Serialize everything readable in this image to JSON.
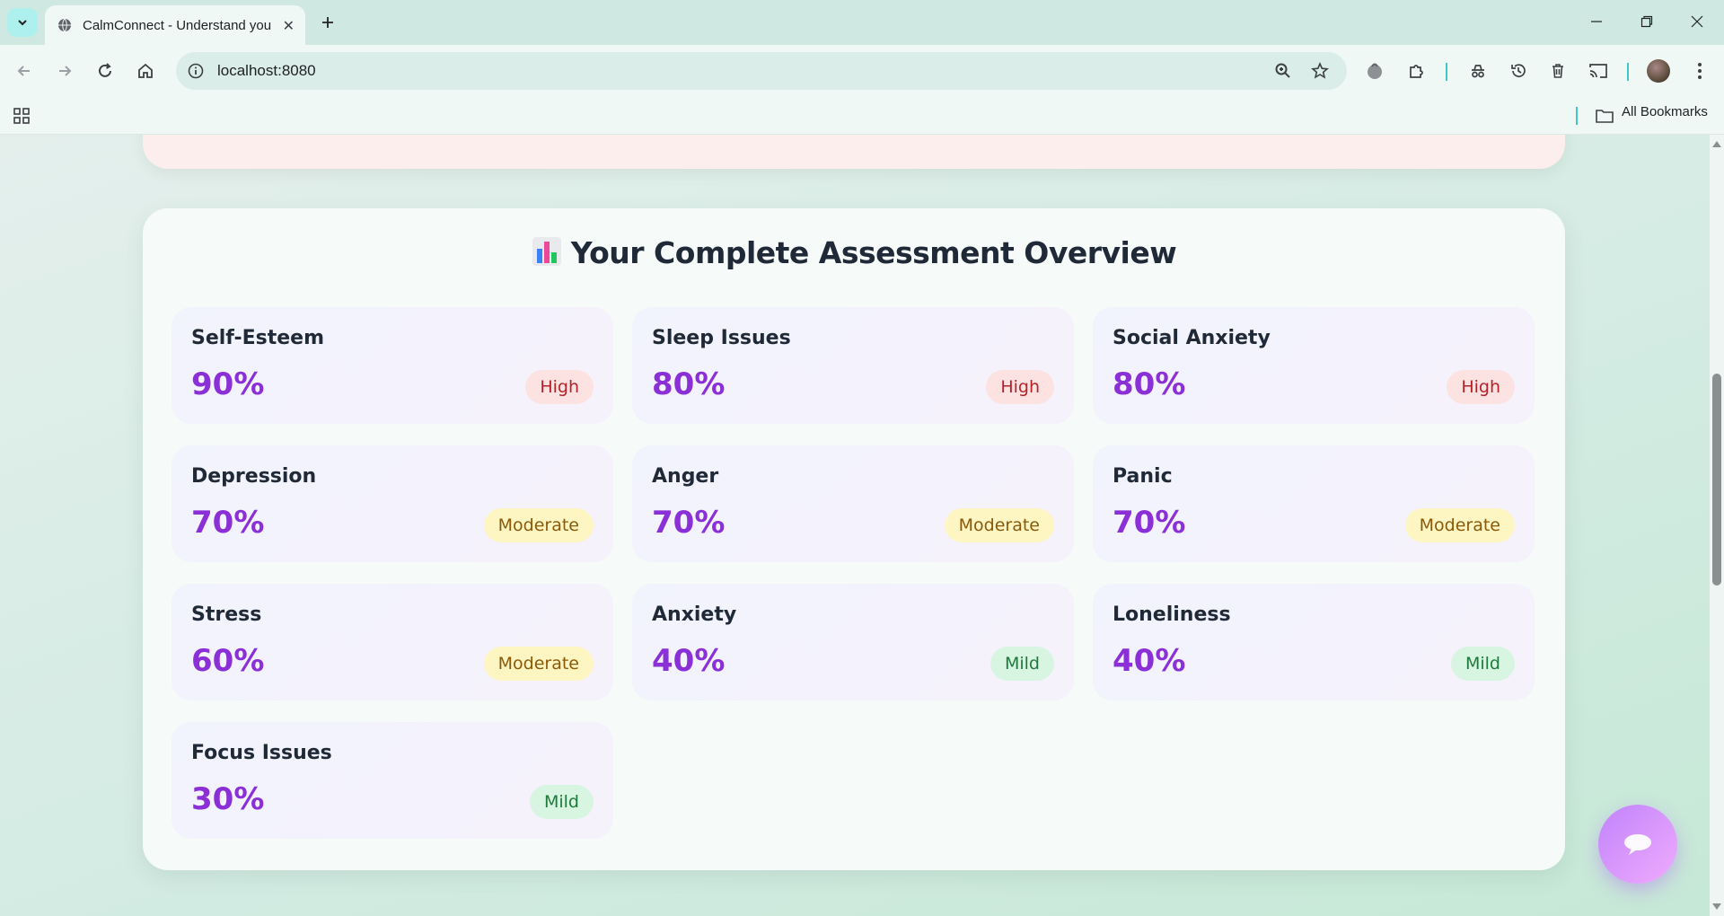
{
  "browser": {
    "tab_title": "CalmConnect - Understand your mind",
    "url": "localhost:8080",
    "bookmarks_label": "All Bookmarks",
    "icons": [
      "tab-search-icon",
      "globe-icon",
      "close-icon",
      "plus-icon",
      "minimize-icon",
      "restore-icon",
      "window-close-icon",
      "back-icon",
      "forward-icon",
      "reload-icon",
      "home-icon",
      "site-info-icon",
      "zoom-icon",
      "star-icon",
      "extension-icon",
      "puzzle-icon",
      "incognito-icon",
      "history-icon",
      "trash-icon",
      "cast-icon",
      "avatar",
      "menu-dots-icon",
      "apps-grid-icon",
      "folder-icon"
    ]
  },
  "overview": {
    "title": "Your Complete Assessment Overview",
    "title_icon": "bar-chart-icon",
    "items": [
      {
        "name": "Self-Esteem",
        "percent": "90%",
        "level": "High"
      },
      {
        "name": "Sleep Issues",
        "percent": "80%",
        "level": "High"
      },
      {
        "name": "Social Anxiety",
        "percent": "80%",
        "level": "High"
      },
      {
        "name": "Depression",
        "percent": "70%",
        "level": "Moderate"
      },
      {
        "name": "Anger",
        "percent": "70%",
        "level": "Moderate"
      },
      {
        "name": "Panic",
        "percent": "70%",
        "level": "Moderate"
      },
      {
        "name": "Stress",
        "percent": "60%",
        "level": "Moderate"
      },
      {
        "name": "Anxiety",
        "percent": "40%",
        "level": "Mild"
      },
      {
        "name": "Loneliness",
        "percent": "40%",
        "level": "Mild"
      },
      {
        "name": "Focus Issues",
        "percent": "30%",
        "level": "Mild"
      }
    ]
  },
  "colors": {
    "percent": "#8b2fd6",
    "high_badge": "#fde2e2",
    "moderate_badge": "#fdf5c2",
    "mild_badge": "#d8f5e2",
    "chat_button": "#c084fc"
  },
  "chat": {
    "icon": "chat-bubble-icon"
  }
}
